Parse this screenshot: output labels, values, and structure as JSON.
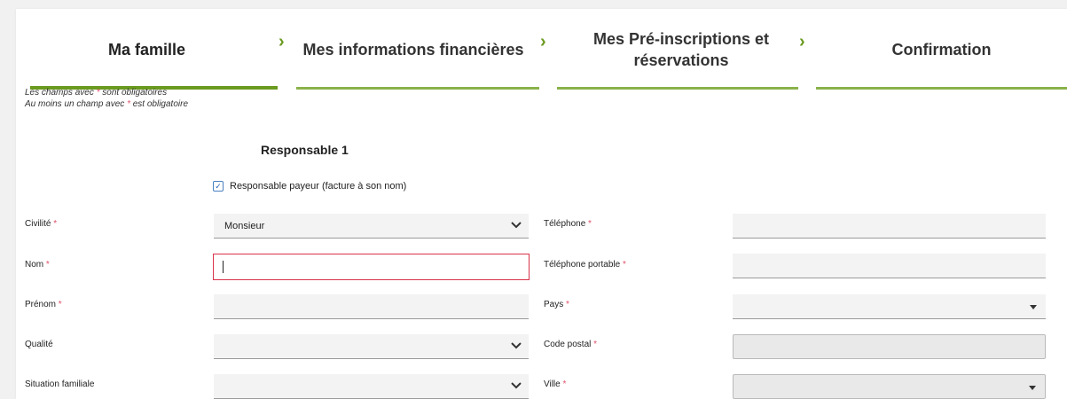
{
  "steps": [
    {
      "label": "Ma famille"
    },
    {
      "label": "Mes informations financières"
    },
    {
      "label_line1": "Mes Pré-inscriptions et",
      "label_line2": "réservations"
    },
    {
      "label": "Confirmation"
    }
  ],
  "notes": {
    "line1_prefix": "Les champs avec ",
    "line1_star": "*",
    "line1_suffix": " sont obligatoires",
    "line2_prefix": "Au moins un champ avec ",
    "line2_star": "*",
    "line2_suffix": " est obligatoire"
  },
  "section_title": "Responsable 1",
  "payer_checkbox": {
    "label": "Responsable payeur (facture à son nom)",
    "checked": true,
    "mark": "✓"
  },
  "required_mark": "*",
  "left_fields": [
    {
      "label": "Civilité",
      "required": true,
      "value": "Monsieur",
      "type": "select"
    },
    {
      "label": "Nom",
      "required": true,
      "value": "",
      "type": "text-focused"
    },
    {
      "label": "Prénom",
      "required": true,
      "value": "",
      "type": "text"
    },
    {
      "label": "Qualité",
      "required": false,
      "value": "",
      "type": "select"
    },
    {
      "label": "Situation familiale",
      "required": false,
      "value": "",
      "type": "select"
    }
  ],
  "right_fields": [
    {
      "label": "Téléphone",
      "required": true,
      "value": "",
      "type": "text"
    },
    {
      "label": "Téléphone portable",
      "required": true,
      "value": "",
      "type": "text"
    },
    {
      "label": "Pays",
      "required": true,
      "value": "",
      "type": "dropdown"
    },
    {
      "label": "Code postal",
      "required": true,
      "value": "",
      "type": "disabled"
    },
    {
      "label": "Ville",
      "required": true,
      "value": "",
      "type": "disabled-dropdown"
    }
  ],
  "colors": {
    "accent_green": "#6a9a1f",
    "required_red": "#e0506a",
    "focus_border": "#d9334a"
  }
}
